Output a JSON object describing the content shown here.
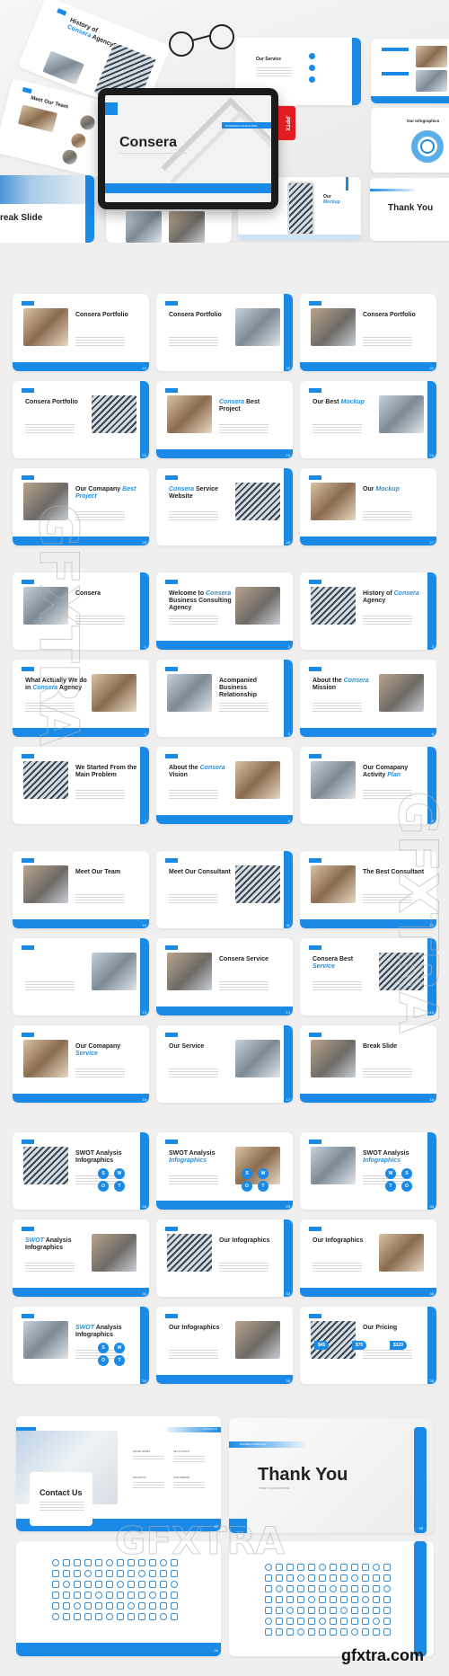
{
  "colors": {
    "accent": "#1a8ae6",
    "pptx_badge": "#e31b23",
    "background": "#efefef"
  },
  "hero": {
    "tablet_title": "Consera",
    "tablet_tag": "BUSINESS CONSULTING",
    "pptx_badge": ".PPTX",
    "slides": {
      "history_title_1": "History of",
      "history_title_accent": "Consera",
      "history_title_2": "Agency",
      "team_title": "Meet Our Team",
      "service_title": "Our Service",
      "infographics_title": "Our Infographics",
      "break_title": "reak Slide",
      "mockup_title_1": "Our",
      "mockup_title_accent": "Mockup",
      "thankyou_title": "Thank You"
    }
  },
  "sections": [
    {
      "slides": [
        {
          "title": "Consera Portfolio",
          "page": "19"
        },
        {
          "title": "Consera Portfolio",
          "page": "20"
        },
        {
          "title": "Consera Portfolio",
          "page": "21"
        },
        {
          "title": "Consera Portfolio",
          "page": "22"
        },
        {
          "title_accent": "Consera",
          "title": "Best Project",
          "page": "23"
        },
        {
          "title": "Our Best",
          "title_accent": "Mockup",
          "page": "24"
        },
        {
          "title": "Our Comapany",
          "title_accent": "Best Project",
          "page": "25"
        },
        {
          "title_accent": "Consera",
          "title": "Service Website",
          "page": "26"
        },
        {
          "title": "Our",
          "title_accent": "Mockup",
          "page": "27"
        }
      ]
    },
    {
      "slides": [
        {
          "title": "Consera",
          "page": "1"
        },
        {
          "title": "Welcome to",
          "title_accent": "Consera",
          "title_2": "Business Consulting Agency",
          "page": "2"
        },
        {
          "title": "History of",
          "title_accent": "Consera",
          "title_2": "Agency",
          "page": "3"
        },
        {
          "title": "What Actually We do in",
          "title_accent": "Consera",
          "title_2": "Agency",
          "page": "4"
        },
        {
          "title": "Acompanied Business Relationship",
          "page": "5"
        },
        {
          "title": "About the",
          "title_accent": "Consera",
          "title_2": "Mission",
          "page": "6"
        },
        {
          "title": "We Started From the Main Problem",
          "page": "7"
        },
        {
          "title": "About the",
          "title_accent": "Consera",
          "title_2": "Vision",
          "page": "8"
        },
        {
          "title": "Our Comapany Activity",
          "title_accent": "Plan",
          "page": "9"
        }
      ]
    },
    {
      "slides": [
        {
          "title": "Meet Our Team",
          "page": "10"
        },
        {
          "title": "Meet Our Consultant",
          "page": "11"
        },
        {
          "title": "The Best Consultant",
          "page": "12"
        },
        {
          "title": "",
          "page": "13"
        },
        {
          "title": "Consera Service",
          "page": "14"
        },
        {
          "title": "Consera  Best",
          "title_accent": "Service",
          "page": "15"
        },
        {
          "title": "Our Comapany",
          "title_accent": "Service",
          "page": "16"
        },
        {
          "title": "Our Service",
          "page": "17"
        },
        {
          "title": "Break Slide",
          "page": "18"
        }
      ]
    },
    {
      "slides": [
        {
          "title": "SWOT Analysis Infographics",
          "page": "28",
          "letters": [
            "S",
            "W",
            "O",
            "T"
          ]
        },
        {
          "title": "SWOT Analysis",
          "title_accent": "Infographics",
          "page": "29",
          "letters": [
            "S",
            "W",
            "O",
            "T"
          ]
        },
        {
          "title": "SWOT Analysis",
          "title_accent": "Infographics",
          "page": "30",
          "letters": [
            "W",
            "S",
            "T",
            "O"
          ]
        },
        {
          "title_accent": "SWOT",
          "title": "Analysis Infographics",
          "page": "31"
        },
        {
          "title": "Our Infographics",
          "page": "32"
        },
        {
          "title": "Our Infographics",
          "page": "33"
        },
        {
          "title_accent": "SWOT",
          "title": "Analysis Infographics",
          "page": "34",
          "letters": [
            "S",
            "W",
            "O",
            "T"
          ]
        },
        {
          "title": "Our Infographics",
          "page": "35"
        },
        {
          "title": "Our Pricing",
          "page": "36",
          "prices": [
            "$45",
            "$75",
            "$120"
          ]
        }
      ]
    },
    {
      "slides": [
        {
          "title": "Contact Us",
          "page": "37",
          "tag": "CONTACT US",
          "fields": [
            "OFFICE HOURS",
            "GET IN TOUCH",
            "FOLLOW US",
            "OUR ADDRESS"
          ]
        },
        {
          "title": "Thank You",
          "page": "38",
          "tag": "BUSINESS CONSULTING",
          "subtitle": "THANK YOU FOR WATCHING"
        },
        {
          "title": "",
          "page": "39"
        },
        {
          "title": "",
          "page": "40"
        }
      ]
    }
  ],
  "watermark": {
    "text": "GFXTRA",
    "site": "gfxtra.com"
  }
}
